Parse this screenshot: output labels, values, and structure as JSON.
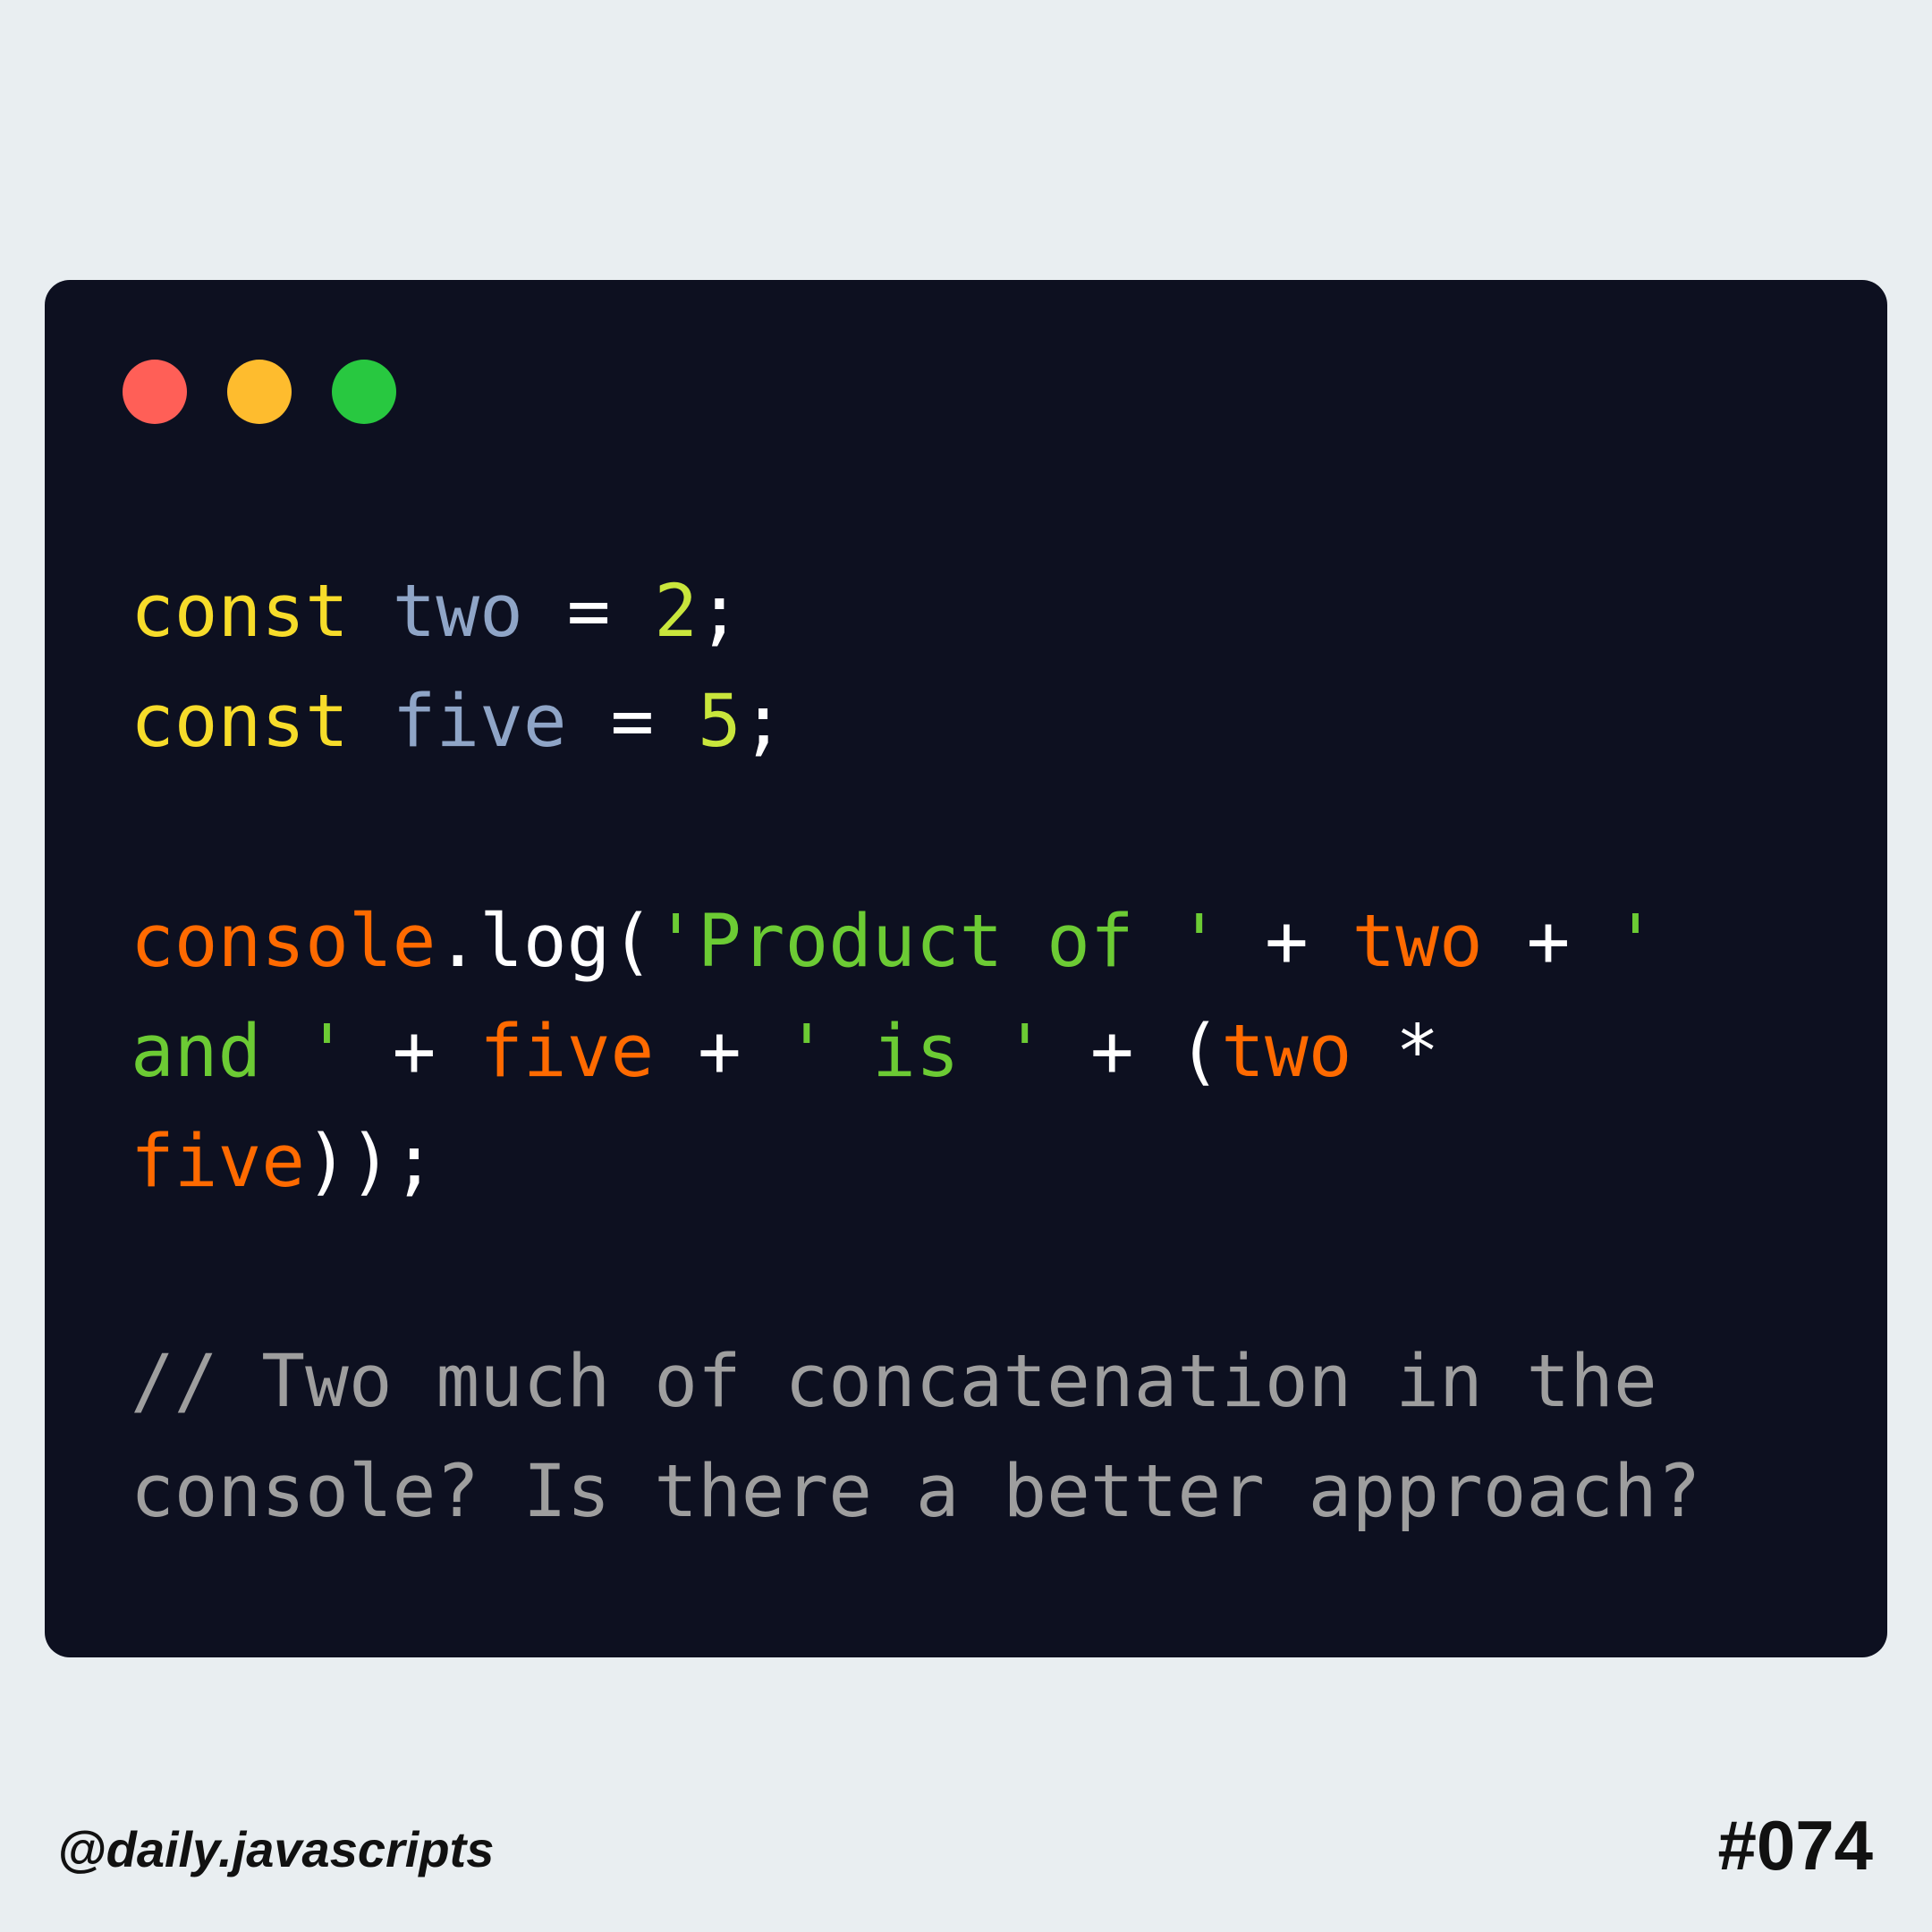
{
  "colors": {
    "page_background": "#e9eef1",
    "window_background": "#0d1020",
    "dot_red": "#ff5f57",
    "dot_yellow": "#febc2e",
    "dot_green": "#28c840",
    "keyword": "#f7dc2a",
    "identifier": "#8fa5c7",
    "operator": "#ffffff",
    "number": "#c9e63c",
    "object": "#ff6a00",
    "string": "#6ccb34",
    "comment": "#9e9e9e",
    "footer_text": "#111111"
  },
  "window_controls": [
    {
      "name": "close",
      "color": "#ff5f57"
    },
    {
      "name": "minimize",
      "color": "#febc2e"
    },
    {
      "name": "maximize",
      "color": "#28c840"
    }
  ],
  "code_lines": [
    [
      {
        "text": "const",
        "type": "keyword"
      },
      {
        "text": " ",
        "type": "operator"
      },
      {
        "text": "two",
        "type": "identifier"
      },
      {
        "text": " = ",
        "type": "operator"
      },
      {
        "text": "2",
        "type": "number"
      },
      {
        "text": ";",
        "type": "operator"
      }
    ],
    [
      {
        "text": "const",
        "type": "keyword"
      },
      {
        "text": " ",
        "type": "operator"
      },
      {
        "text": "five",
        "type": "identifier"
      },
      {
        "text": " = ",
        "type": "operator"
      },
      {
        "text": "5",
        "type": "number"
      },
      {
        "text": ";",
        "type": "operator"
      }
    ],
    [],
    [
      {
        "text": "console",
        "type": "object"
      },
      {
        "text": ".log(",
        "type": "operator"
      },
      {
        "text": "'Product of '",
        "type": "string"
      },
      {
        "text": " + ",
        "type": "operator"
      },
      {
        "text": "two",
        "type": "object"
      },
      {
        "text": " + ",
        "type": "operator"
      },
      {
        "text": "'",
        "type": "string"
      }
    ],
    [
      {
        "text": "and '",
        "type": "string"
      },
      {
        "text": " + ",
        "type": "operator"
      },
      {
        "text": "five",
        "type": "object"
      },
      {
        "text": " + ",
        "type": "operator"
      },
      {
        "text": "' is '",
        "type": "string"
      },
      {
        "text": " + (",
        "type": "operator"
      },
      {
        "text": "two",
        "type": "object"
      },
      {
        "text": " *",
        "type": "operator"
      }
    ],
    [
      {
        "text": "five",
        "type": "object"
      },
      {
        "text": "));",
        "type": "operator"
      }
    ],
    [],
    [
      {
        "text": "// Two much of concatenation in the",
        "type": "comment"
      }
    ],
    [
      {
        "text": "console? Is there a better approach?",
        "type": "comment"
      }
    ]
  ],
  "footer": {
    "handle": "@daily.javascripts",
    "post_number": "#074"
  }
}
